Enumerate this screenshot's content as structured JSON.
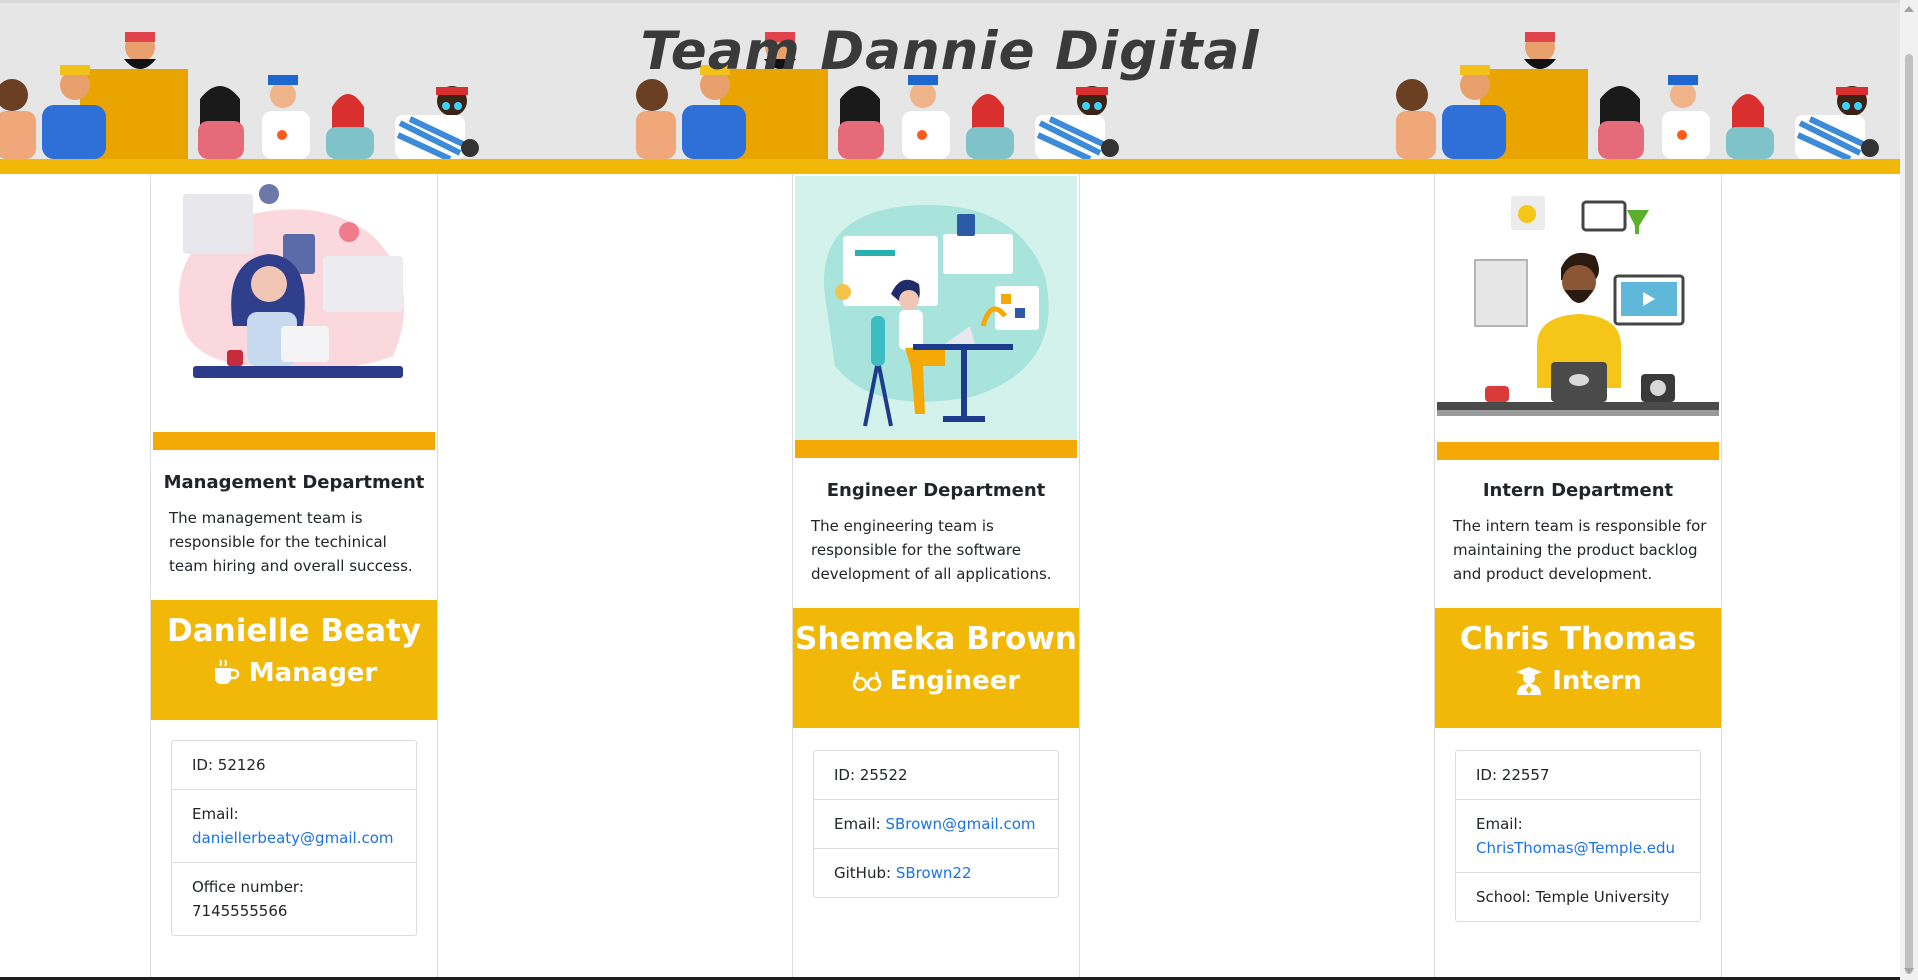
{
  "header": {
    "title": "Team Dannie Digital"
  },
  "colors": {
    "accent": "#f2b807",
    "stripe": "#f5a907",
    "link": "#1a73e8"
  },
  "cards": [
    {
      "department": "Management Department",
      "description": "The management team is responsible for the techinical team hiring and overall success.",
      "name": "Danielle Beaty",
      "role": "Manager",
      "role_icon": "coffee-icon",
      "id_label": "ID: 52126",
      "email_label": "Email:",
      "email": "daniellerbeaty@gmail.com",
      "extra": "Office number: 7145555566"
    },
    {
      "department": "Engineer Department",
      "description": "The engineering team is responsible for the software development of all applications.",
      "name": "Shemeka Brown",
      "role": "Engineer",
      "role_icon": "glasses-icon",
      "id_label": "ID: 25522",
      "email_label": "Email:",
      "email": "SBrown@gmail.com",
      "extra_label": "GitHub:",
      "extra_link": "SBrown22"
    },
    {
      "department": "Intern Department",
      "description": "The intern team is responsible for maintaining the product backlog and product development.",
      "name": "Chris Thomas",
      "role": "Intern",
      "role_icon": "graduate-icon",
      "id_label": "ID: 22557",
      "email_label": "Email:",
      "email": "ChrisThomas@Temple.edu",
      "extra": "School: Temple University"
    }
  ]
}
